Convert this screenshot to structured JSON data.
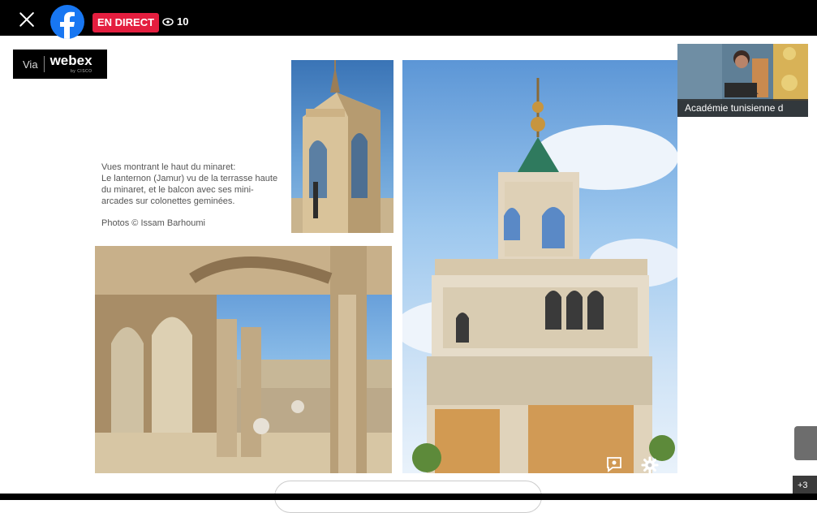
{
  "topbar": {
    "live_label": "EN DIRECT",
    "viewer_count": "10",
    "icons": [
      "close-icon",
      "facebook-logo",
      "eye-icon"
    ]
  },
  "webex": {
    "via": "Via",
    "brand": "webex",
    "sub": "by CISCO"
  },
  "slide": {
    "caption_line1": "Vues montrant le haut du minaret:",
    "caption_line2": "Le lanternon (Jamur) vu de la terrasse haute",
    "caption_line3": "du minaret, et le balcon avec ses mini-",
    "caption_line4": "arcades sur colonettes geminées.",
    "credit": "Photos © Issam Barhoumi"
  },
  "video": {
    "participant_label": "Académie tunisienne d"
  },
  "side_panel": {
    "close": "×",
    "more_count": "+3"
  },
  "colors": {
    "live_red": "#e41e3f",
    "facebook_blue": "#1877f2"
  }
}
